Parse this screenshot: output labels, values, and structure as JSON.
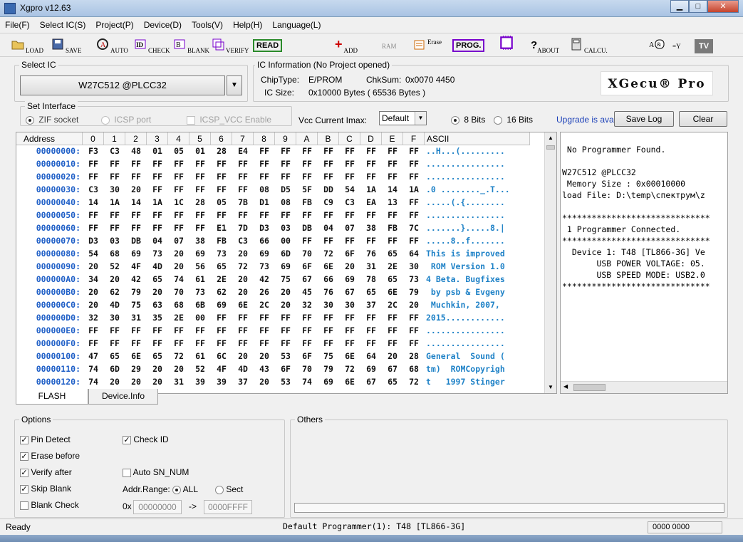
{
  "window": {
    "title": "Xgpro v12.63",
    "min": "▁",
    "max": "□",
    "close": "✕"
  },
  "menu": [
    "File(F)",
    "Select IC(S)",
    "Project(P)",
    "Device(D)",
    "Tools(V)",
    "Help(H)",
    "Language(L)"
  ],
  "toolbar": {
    "load": "LOAD",
    "save": "SAVE",
    "auto": "AUTO",
    "id": "ID",
    "check": "CHECK",
    "blank": "BLANK",
    "verify": "VERIFY",
    "read": "READ",
    "add": "ADD",
    "ram": "RAM",
    "erase": "Erase",
    "prog": "PROG.",
    "about": "ABOUT",
    "calcu": "CALCU.",
    "logic": "=Y",
    "tv": "TV"
  },
  "select_ic": {
    "label": "Select IC",
    "value": "W27C512 @PLCC32"
  },
  "ic_info": {
    "label": "IC Information (No Project opened)",
    "chip_type_label": "ChipType:",
    "chip_type": "E/PROM",
    "chksum_label": "ChkSum:",
    "chksum": "0x0070 4450",
    "ic_size_label": "IC Size:",
    "ic_size": "0x10000 Bytes ( 65536 Bytes )",
    "logo": "XGecu® Pro"
  },
  "interface": {
    "label": "Set Interface",
    "zif": "ZIF socket",
    "icsp": "ICSP port",
    "icsp_vcc": "ICSP_VCC Enable"
  },
  "vcc": {
    "label": "Vcc Current Imax:",
    "value": "Default"
  },
  "bits": {
    "b8": "8 Bits",
    "b16": "16 Bits"
  },
  "upgrade": "Upgrade is avai",
  "buttons": {
    "save_log": "Save Log",
    "clear": "Clear"
  },
  "hex": {
    "headers": [
      "Address",
      "0",
      "1",
      "2",
      "3",
      "4",
      "5",
      "6",
      "7",
      "8",
      "9",
      "A",
      "B",
      "C",
      "D",
      "E",
      "F",
      "ASCII"
    ],
    "rows": [
      {
        "addr": "00000000:",
        "bytes": [
          "F3",
          "C3",
          "48",
          "01",
          "05",
          "01",
          "28",
          "E4",
          "FF",
          "FF",
          "FF",
          "FF",
          "FF",
          "FF",
          "FF",
          "FF"
        ],
        "ascii": "..H...(........."
      },
      {
        "addr": "00000010:",
        "bytes": [
          "FF",
          "FF",
          "FF",
          "FF",
          "FF",
          "FF",
          "FF",
          "FF",
          "FF",
          "FF",
          "FF",
          "FF",
          "FF",
          "FF",
          "FF",
          "FF"
        ],
        "ascii": "................"
      },
      {
        "addr": "00000020:",
        "bytes": [
          "FF",
          "FF",
          "FF",
          "FF",
          "FF",
          "FF",
          "FF",
          "FF",
          "FF",
          "FF",
          "FF",
          "FF",
          "FF",
          "FF",
          "FF",
          "FF"
        ],
        "ascii": "................"
      },
      {
        "addr": "00000030:",
        "bytes": [
          "C3",
          "30",
          "20",
          "FF",
          "FF",
          "FF",
          "FF",
          "FF",
          "08",
          "D5",
          "5F",
          "DD",
          "54",
          "1A",
          "14",
          "1A"
        ],
        "ascii": ".0 ........_.T..."
      },
      {
        "addr": "00000040:",
        "bytes": [
          "14",
          "1A",
          "14",
          "1A",
          "1C",
          "28",
          "05",
          "7B",
          "D1",
          "08",
          "FB",
          "C9",
          "C3",
          "EA",
          "13",
          "FF"
        ],
        "ascii": ".....(.{........"
      },
      {
        "addr": "00000050:",
        "bytes": [
          "FF",
          "FF",
          "FF",
          "FF",
          "FF",
          "FF",
          "FF",
          "FF",
          "FF",
          "FF",
          "FF",
          "FF",
          "FF",
          "FF",
          "FF",
          "FF"
        ],
        "ascii": "................"
      },
      {
        "addr": "00000060:",
        "bytes": [
          "FF",
          "FF",
          "FF",
          "FF",
          "FF",
          "FF",
          "E1",
          "7D",
          "D3",
          "03",
          "DB",
          "04",
          "07",
          "38",
          "FB",
          "7C"
        ],
        "ascii": ".......}.....8.|"
      },
      {
        "addr": "00000070:",
        "bytes": [
          "D3",
          "03",
          "DB",
          "04",
          "07",
          "38",
          "FB",
          "C3",
          "66",
          "00",
          "FF",
          "FF",
          "FF",
          "FF",
          "FF",
          "FF"
        ],
        "ascii": ".....8..f......."
      },
      {
        "addr": "00000080:",
        "bytes": [
          "54",
          "68",
          "69",
          "73",
          "20",
          "69",
          "73",
          "20",
          "69",
          "6D",
          "70",
          "72",
          "6F",
          "76",
          "65",
          "64"
        ],
        "ascii": "This is improved"
      },
      {
        "addr": "00000090:",
        "bytes": [
          "20",
          "52",
          "4F",
          "4D",
          "20",
          "56",
          "65",
          "72",
          "73",
          "69",
          "6F",
          "6E",
          "20",
          "31",
          "2E",
          "30"
        ],
        "ascii": " ROM Version 1.0"
      },
      {
        "addr": "000000A0:",
        "bytes": [
          "34",
          "20",
          "42",
          "65",
          "74",
          "61",
          "2E",
          "20",
          "42",
          "75",
          "67",
          "66",
          "69",
          "78",
          "65",
          "73"
        ],
        "ascii": "4 Beta. Bugfixes"
      },
      {
        "addr": "000000B0:",
        "bytes": [
          "20",
          "62",
          "79",
          "20",
          "70",
          "73",
          "62",
          "20",
          "26",
          "20",
          "45",
          "76",
          "67",
          "65",
          "6E",
          "79"
        ],
        "ascii": " by psb & Evgeny"
      },
      {
        "addr": "000000C0:",
        "bytes": [
          "20",
          "4D",
          "75",
          "63",
          "68",
          "6B",
          "69",
          "6E",
          "2C",
          "20",
          "32",
          "30",
          "30",
          "37",
          "2C",
          "20"
        ],
        "ascii": " Muchkin, 2007, "
      },
      {
        "addr": "000000D0:",
        "bytes": [
          "32",
          "30",
          "31",
          "35",
          "2E",
          "00",
          "FF",
          "FF",
          "FF",
          "FF",
          "FF",
          "FF",
          "FF",
          "FF",
          "FF",
          "FF"
        ],
        "ascii": "2015............"
      },
      {
        "addr": "000000E0:",
        "bytes": [
          "FF",
          "FF",
          "FF",
          "FF",
          "FF",
          "FF",
          "FF",
          "FF",
          "FF",
          "FF",
          "FF",
          "FF",
          "FF",
          "FF",
          "FF",
          "FF"
        ],
        "ascii": "................"
      },
      {
        "addr": "000000F0:",
        "bytes": [
          "FF",
          "FF",
          "FF",
          "FF",
          "FF",
          "FF",
          "FF",
          "FF",
          "FF",
          "FF",
          "FF",
          "FF",
          "FF",
          "FF",
          "FF",
          "FF"
        ],
        "ascii": "................"
      },
      {
        "addr": "00000100:",
        "bytes": [
          "47",
          "65",
          "6E",
          "65",
          "72",
          "61",
          "6C",
          "20",
          "20",
          "53",
          "6F",
          "75",
          "6E",
          "64",
          "20",
          "28"
        ],
        "ascii": "General  Sound ("
      },
      {
        "addr": "00000110:",
        "bytes": [
          "74",
          "6D",
          "29",
          "20",
          "20",
          "52",
          "4F",
          "4D",
          "43",
          "6F",
          "70",
          "79",
          "72",
          "69",
          "67",
          "68"
        ],
        "ascii": "tm)  ROMCopyrigh"
      },
      {
        "addr": "00000120:",
        "bytes": [
          "74",
          "20",
          "20",
          "20",
          "31",
          "39",
          "39",
          "37",
          "20",
          "53",
          "74",
          "69",
          "6E",
          "67",
          "65",
          "72"
        ],
        "ascii": "t   1997 Stinger"
      }
    ]
  },
  "log": [
    " No Programmer Found.",
    "",
    "W27C512 @PLCC32",
    " Memory Size : 0x00010000",
    "load File: D:\\temp\\спектрум\\z",
    "",
    "******************************",
    " 1 Programmer Connected.",
    "******************************",
    "  Device 1: T48 [TL866-3G] Ve",
    "       USB POWER VOLTAGE: 05.",
    "       USB SPEED MODE: USB2.0",
    "******************************"
  ],
  "tabs": [
    "FLASH",
    "Device.Info"
  ],
  "options": {
    "label": "Options",
    "pin_detect": "Pin Detect",
    "check_id": "Check ID",
    "erase_before": "Erase before",
    "verify_after": "Verify after",
    "auto_sn": "Auto SN_NUM",
    "skip_blank": "Skip Blank",
    "addr_range": "Addr.Range:",
    "all": "ALL",
    "sect": "Sect",
    "blank_check": "Blank Check",
    "ox": "0x",
    "from": "00000000",
    "arrow": "->",
    "to": "0000FFFF"
  },
  "others": {
    "label": "Others"
  },
  "status": {
    "left": "Ready",
    "center": "Default Programmer(1): T48 [TL866-3G]",
    "right": "0000 0000"
  }
}
